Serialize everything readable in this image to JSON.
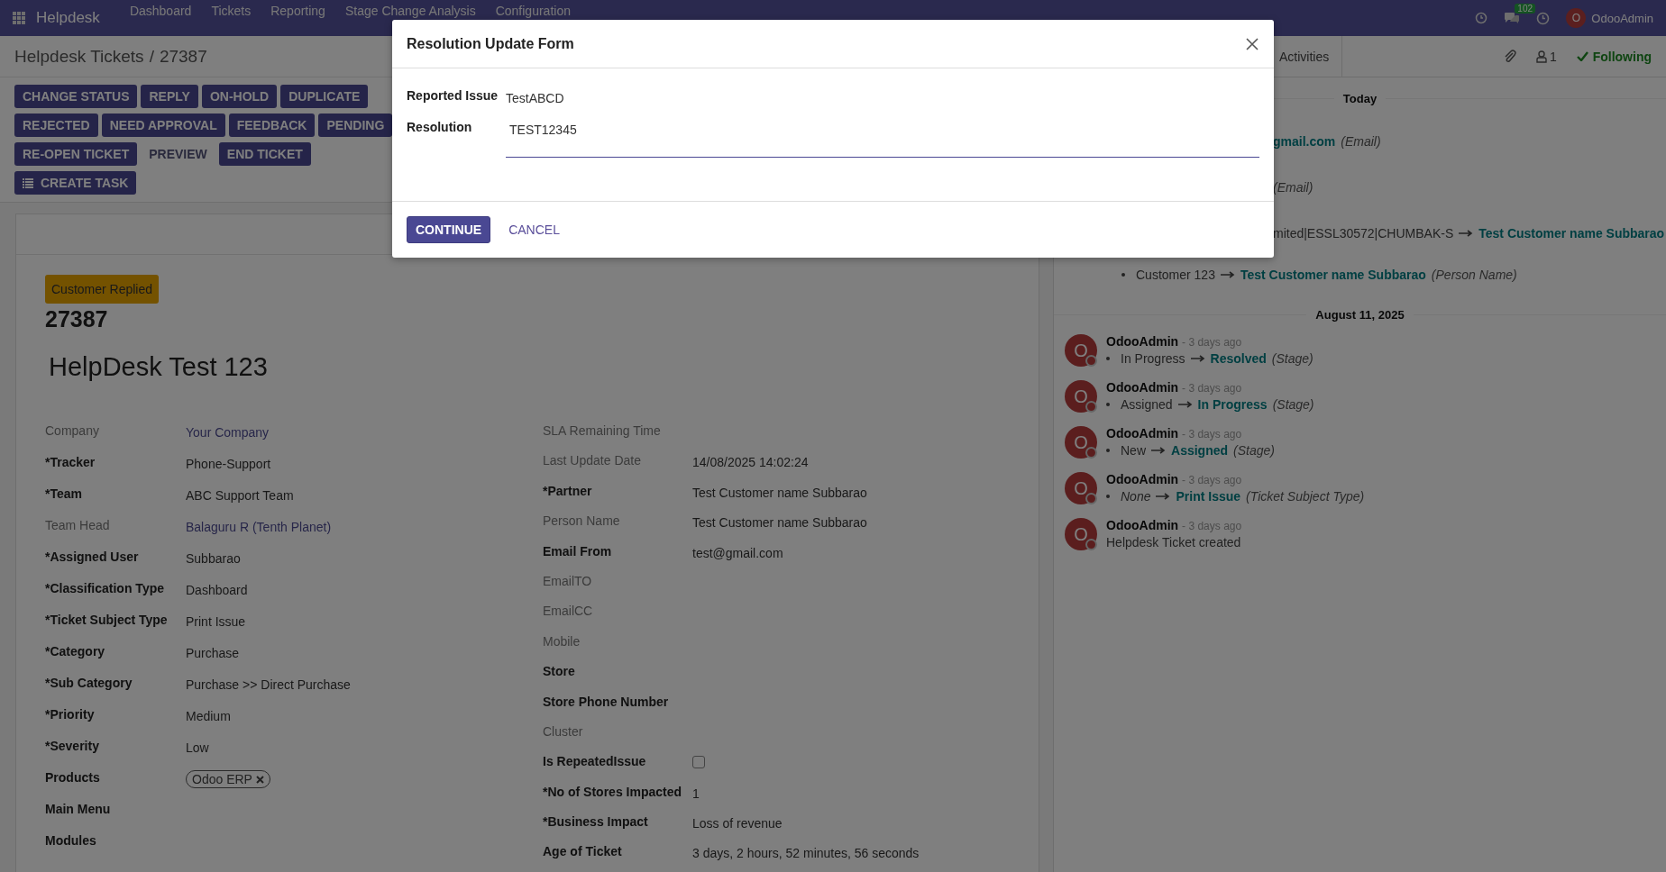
{
  "navbar": {
    "app": "Helpdesk",
    "menu": [
      "Dashboard",
      "Tickets",
      "Reporting",
      "Stage Change Analysis",
      "Configuration"
    ],
    "message_count": "102",
    "user": {
      "avatar": "O",
      "name": "OdooAdmin"
    }
  },
  "breadcrumb": {
    "parent": "Helpdesk Tickets",
    "separator": "/",
    "current": "27387"
  },
  "action_rows": [
    [
      {
        "label": "CHANGE STATUS",
        "kind": "primary"
      },
      {
        "label": "REPLY",
        "kind": "primary"
      },
      {
        "label": "ON-HOLD",
        "kind": "primary"
      },
      {
        "label": "DUPLICATE",
        "kind": "primary"
      }
    ],
    [
      {
        "label": "REJECTED",
        "kind": "primary"
      },
      {
        "label": "NEED APPROVAL",
        "kind": "primary"
      },
      {
        "label": "FEEDBACK",
        "kind": "primary"
      },
      {
        "label": "PENDING",
        "kind": "primary"
      }
    ],
    [
      {
        "label": "RE-OPEN TICKET",
        "kind": "primary"
      },
      {
        "label": "PREVIEW",
        "kind": "link"
      },
      {
        "label": "END TICKET",
        "kind": "primary"
      }
    ],
    [
      {
        "label": "CREATE TASK",
        "kind": "task"
      }
    ]
  ],
  "ticket": {
    "stage_badge": "Customer Replied",
    "number": "27387",
    "title": "HelpDesk Test 123",
    "left_fields": [
      {
        "label": "Company",
        "readonly": true,
        "kind": "link",
        "value": "Your Company"
      },
      {
        "label": "*Tracker",
        "readonly": false,
        "kind": "text",
        "value": "Phone-Support"
      },
      {
        "label": "*Team",
        "readonly": false,
        "kind": "text",
        "value": "ABC Support Team"
      },
      {
        "label": "Team Head",
        "readonly": true,
        "kind": "link",
        "value": "Balaguru R (Tenth Planet)"
      },
      {
        "label": "*Assigned User",
        "readonly": false,
        "kind": "text",
        "value": "Subbarao"
      },
      {
        "label": "*Classification Type",
        "readonly": false,
        "kind": "text",
        "value": "Dashboard"
      },
      {
        "label": "*Ticket Subject Type",
        "readonly": false,
        "kind": "text",
        "value": "Print Issue"
      },
      {
        "label": "*Category",
        "readonly": false,
        "kind": "text",
        "value": "Purchase"
      },
      {
        "label": "*Sub Category",
        "readonly": false,
        "kind": "text",
        "value": "Purchase >> Direct Purchase"
      },
      {
        "label": "*Priority",
        "readonly": false,
        "kind": "text",
        "value": "Medium"
      },
      {
        "label": "*Severity",
        "readonly": false,
        "kind": "text",
        "value": "Low"
      },
      {
        "label": "Products",
        "readonly": false,
        "kind": "tag",
        "value": "Odoo ERP"
      },
      {
        "label": "Main Menu",
        "readonly": false,
        "kind": "text"
      },
      {
        "label": "Modules",
        "readonly": false,
        "kind": "text"
      }
    ],
    "right_fields": [
      {
        "label": "SLA Remaining Time",
        "readonly": true,
        "kind": "text"
      },
      {
        "label": "Last Update Date",
        "readonly": true,
        "kind": "text",
        "value": "14/08/2025 14:02:24"
      },
      {
        "label": "*Partner",
        "readonly": false,
        "kind": "text",
        "value": "Test Customer name Subbarao"
      },
      {
        "label": "Person Name",
        "readonly": true,
        "kind": "text",
        "value": "Test Customer name Subbarao"
      },
      {
        "label": "Email From",
        "readonly": false,
        "kind": "text",
        "value": "test@gmail.com"
      },
      {
        "label": "EmailTO",
        "readonly": true,
        "kind": "text"
      },
      {
        "label": "EmailCC",
        "readonly": true,
        "kind": "text"
      },
      {
        "label": "Mobile",
        "readonly": true,
        "kind": "text"
      },
      {
        "label": "Store",
        "readonly": false,
        "kind": "text"
      },
      {
        "label": "Store Phone Number",
        "readonly": false,
        "kind": "text"
      },
      {
        "label": "Cluster",
        "readonly": true,
        "kind": "text"
      },
      {
        "label": "Is RepeatedIssue",
        "readonly": false,
        "kind": "checkbox",
        "checked": false
      },
      {
        "label": "*No of Stores Impacted",
        "readonly": false,
        "kind": "text",
        "value": "1"
      },
      {
        "label": "*Business Impact",
        "readonly": false,
        "kind": "text",
        "value": "Loss of revenue"
      },
      {
        "label": "Age of Ticket",
        "readonly": false,
        "kind": "text",
        "value": "3 days, 2 hours, 52 minutes, 56 seconds"
      }
    ]
  },
  "chatter": {
    "activities": "Activities",
    "followers": "1",
    "follow": "Following",
    "groups": [
      {
        "date": "Today",
        "entries": [
          {
            "clipped": true,
            "new": "gmail.com",
            "field": "(Email)"
          },
          {
            "clipped": true,
            "field": "(Email)"
          },
          {
            "clipped": true,
            "old": "mited|ESSL30572|CHUMBAK-S",
            "new": "Test Customer name Subbarao"
          },
          {
            "clipped": false,
            "old": "Customer 123",
            "new": "Test Customer name Subbarao",
            "field": "(Person Name)"
          }
        ]
      },
      {
        "date": "August 11, 2025",
        "messages": [
          {
            "avatar": "O",
            "author": "OdooAdmin",
            "time": "- 3 days ago",
            "changes": [
              {
                "old": "In Progress",
                "old_empty": false,
                "new": "Resolved",
                "field": "(Stage)"
              }
            ]
          },
          {
            "avatar": "O",
            "author": "OdooAdmin",
            "time": "- 3 days ago",
            "changes": [
              {
                "old": "Assigned",
                "old_empty": false,
                "new": "In Progress",
                "field": "(Stage)"
              }
            ]
          },
          {
            "avatar": "O",
            "author": "OdooAdmin",
            "time": "- 3 days ago",
            "changes": [
              {
                "old": "New",
                "old_empty": false,
                "new": "Assigned",
                "field": "(Stage)"
              }
            ]
          },
          {
            "avatar": "O",
            "author": "OdooAdmin",
            "time": "- 3 days ago",
            "changes": [
              {
                "old": "None",
                "old_empty": true,
                "new": "Print Issue",
                "field": "(Ticket Subject Type)"
              }
            ]
          },
          {
            "avatar": "O",
            "author": "OdooAdmin",
            "time": "- 3 days ago",
            "body": "Helpdesk Ticket created"
          }
        ]
      }
    ]
  },
  "dialog": {
    "title": "Resolution Update Form",
    "fields": [
      {
        "label": "Reported Issue",
        "kind": "text",
        "value": "TestABCD"
      },
      {
        "label": "Resolution",
        "kind": "input",
        "value": "TEST12345"
      }
    ],
    "buttons": [
      {
        "label": "CONTINUE",
        "kind": "primary"
      },
      {
        "label": "CANCEL",
        "kind": "link"
      }
    ]
  }
}
